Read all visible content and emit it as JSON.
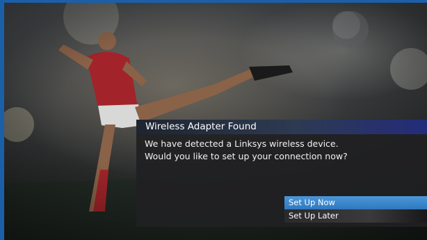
{
  "dialog": {
    "title": "Wireless Adapter Found",
    "message_lines": [
      "We have detected a Linksys wireless device.",
      "Would you like to set up your connection now?"
    ],
    "options": [
      {
        "label": "Set Up Now",
        "selected": true
      },
      {
        "label": "Set Up Later",
        "selected": false
      }
    ]
  },
  "colors": {
    "accent": "#2e78c0",
    "frame_border": "#1b5fa8",
    "title_bar": "#2d3a52"
  }
}
